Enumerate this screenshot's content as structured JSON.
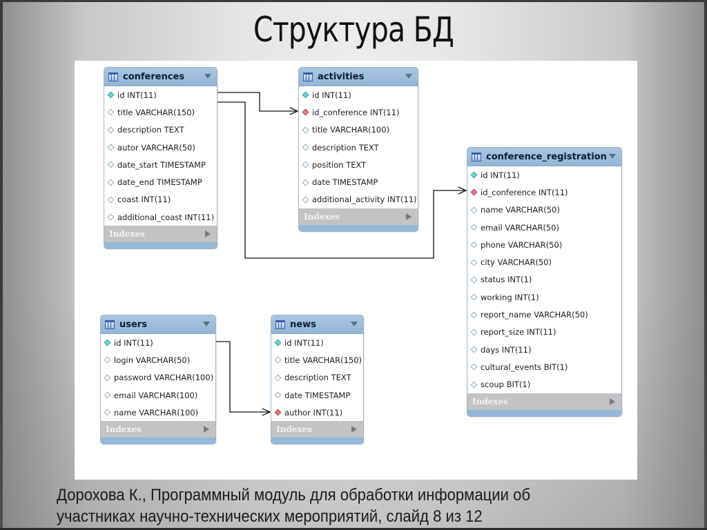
{
  "slide": {
    "title": "Структура БД",
    "footer_line1": "Дорохова К., Программный модуль для обработки информации об",
    "footer_line2": "участниках научно-технических мероприятий, слайд 8 из 12"
  },
  "diagram": {
    "indexes_label": "Indexes",
    "tables": {
      "conferences": {
        "name": "conferences",
        "columns": [
          {
            "text": "id INT(11)",
            "key": "pk"
          },
          {
            "text": "title VARCHAR(150)",
            "key": "col"
          },
          {
            "text": "description TEXT",
            "key": "col"
          },
          {
            "text": "autor VARCHAR(50)",
            "key": "col"
          },
          {
            "text": "date_start TIMESTAMP",
            "key": "col"
          },
          {
            "text": "date_end TIMESTAMP",
            "key": "col"
          },
          {
            "text": "coast INT(11)",
            "key": "col"
          },
          {
            "text": "additional_coast INT(11)",
            "key": "col"
          }
        ]
      },
      "activities": {
        "name": "activities",
        "columns": [
          {
            "text": "id INT(11)",
            "key": "pk"
          },
          {
            "text": "id_conference INT(11)",
            "key": "fk"
          },
          {
            "text": "title VARCHAR(100)",
            "key": "col"
          },
          {
            "text": "description TEXT",
            "key": "col"
          },
          {
            "text": "position TEXT",
            "key": "col"
          },
          {
            "text": "date TIMESTAMP",
            "key": "col"
          },
          {
            "text": "additional_activity INT(11)",
            "key": "col"
          }
        ]
      },
      "conference_registration": {
        "name": "conference_registration",
        "columns": [
          {
            "text": "id INT(11)",
            "key": "pk"
          },
          {
            "text": "id_conference INT(11)",
            "key": "fk"
          },
          {
            "text": "name VARCHAR(50)",
            "key": "col"
          },
          {
            "text": "email VARCHAR(50)",
            "key": "col"
          },
          {
            "text": "phone VARCHAR(50)",
            "key": "col"
          },
          {
            "text": "city VARCHAR(50)",
            "key": "col"
          },
          {
            "text": "status INT(1)",
            "key": "col"
          },
          {
            "text": "working INT(1)",
            "key": "col"
          },
          {
            "text": "report_name VARCHAR(50)",
            "key": "col"
          },
          {
            "text": "report_size INT(11)",
            "key": "col"
          },
          {
            "text": "days INT(11)",
            "key": "col"
          },
          {
            "text": "cultural_events BIT(1)",
            "key": "col"
          },
          {
            "text": "scoup BIT(1)",
            "key": "col"
          }
        ]
      },
      "users": {
        "name": "users",
        "columns": [
          {
            "text": "id INT(11)",
            "key": "pk"
          },
          {
            "text": "login VARCHAR(50)",
            "key": "col"
          },
          {
            "text": "password VARCHAR(100)",
            "key": "col"
          },
          {
            "text": "email VARCHAR(100)",
            "key": "col"
          },
          {
            "text": "name VARCHAR(100)",
            "key": "col"
          }
        ]
      },
      "news": {
        "name": "news",
        "columns": [
          {
            "text": "id INT(11)",
            "key": "pk"
          },
          {
            "text": "title VARCHAR(150)",
            "key": "col"
          },
          {
            "text": "description TEXT",
            "key": "col"
          },
          {
            "text": "date TIMESTAMP",
            "key": "col"
          },
          {
            "text": "author INT(11)",
            "key": "fk"
          }
        ]
      }
    },
    "relationships": [
      {
        "from": "conferences.id",
        "to": "activities.id_conference"
      },
      {
        "from": "conferences.id",
        "to": "conference_registration.id_conference"
      },
      {
        "from": "users.id",
        "to": "news.author"
      }
    ]
  }
}
